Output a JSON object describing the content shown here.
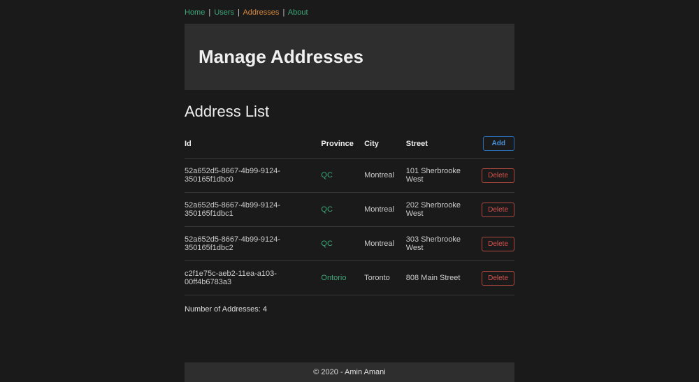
{
  "breadcrumb": {
    "items": [
      {
        "label": "Home",
        "style": "green"
      },
      {
        "label": "Users",
        "style": "green"
      },
      {
        "label": "Addresses",
        "style": "orange"
      },
      {
        "label": "About",
        "style": "green"
      }
    ],
    "separator": "|"
  },
  "page": {
    "title": "Manage Addresses",
    "section_title": "Address List"
  },
  "table": {
    "headers": {
      "id": "Id",
      "province": "Province",
      "city": "City",
      "street": "Street"
    },
    "rows": [
      {
        "id": "52a652d5-8667-4b99-9124-350165f1dbc0",
        "province": "QC",
        "city": "Montreal",
        "street": "101 Sherbrooke West"
      },
      {
        "id": "52a652d5-8667-4b99-9124-350165f1dbc1",
        "province": "QC",
        "city": "Montreal",
        "street": "202 Sherbrooke West"
      },
      {
        "id": "52a652d5-8667-4b99-9124-350165f1dbc2",
        "province": "QC",
        "city": "Montreal",
        "street": "303 Sherbrooke West"
      },
      {
        "id": "c2f1e75c-aeb2-11ea-a103-00ff4b6783a3",
        "province": "Ontorio",
        "city": "Toronto",
        "street": "808 Main Street"
      }
    ]
  },
  "buttons": {
    "add": "Add",
    "delete": "Delete"
  },
  "summary": {
    "count_label": "Number of Addresses: 4"
  },
  "footer": {
    "text": "© 2020 - Amin Amani"
  }
}
